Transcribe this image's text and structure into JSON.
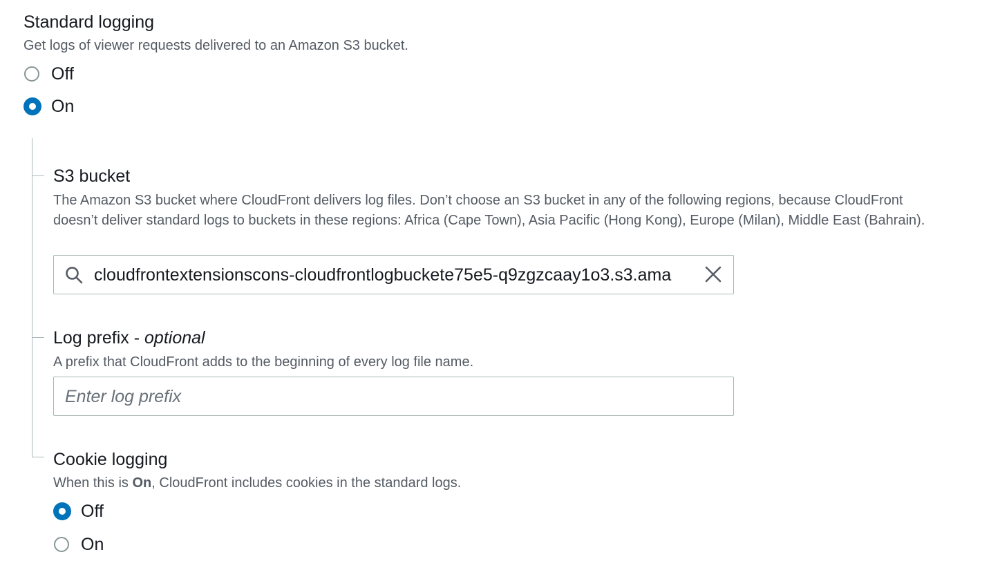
{
  "standard_logging": {
    "title": "Standard logging",
    "description": "Get logs of viewer requests delivered to an Amazon S3 bucket.",
    "options": [
      {
        "label": "Off",
        "selected": false
      },
      {
        "label": "On",
        "selected": true
      }
    ]
  },
  "s3_bucket": {
    "title": "S3 bucket",
    "description": "The Amazon S3 bucket where CloudFront delivers log files. Don’t choose an S3 bucket in any of the following regions, because CloudFront doesn’t deliver standard logs to buckets in these regions: Africa (Cape Town), Asia Pacific (Hong Kong), Europe (Milan), Middle East (Bahrain).",
    "value": "cloudfrontextensionscons-cloudfrontlogbuckete75e5-q9zgzcaay1o3.s3.ama",
    "search_icon": "search-icon",
    "clear_icon": "close-icon"
  },
  "log_prefix": {
    "title": "Log prefix - ",
    "title_optional": "optional",
    "description": "A prefix that CloudFront adds to the beginning of every log file name.",
    "value": "",
    "placeholder": "Enter log prefix"
  },
  "cookie_logging": {
    "title": "Cookie logging",
    "description_prefix": "When this is ",
    "description_bold": "On",
    "description_suffix": ", CloudFront includes cookies in the standard logs.",
    "options": [
      {
        "label": "Off",
        "selected": true
      },
      {
        "label": "On",
        "selected": false
      }
    ]
  },
  "colors": {
    "accent": "#0073bb",
    "text": "#16191f",
    "secondary_text": "#545b64",
    "border": "#aab7b8"
  }
}
